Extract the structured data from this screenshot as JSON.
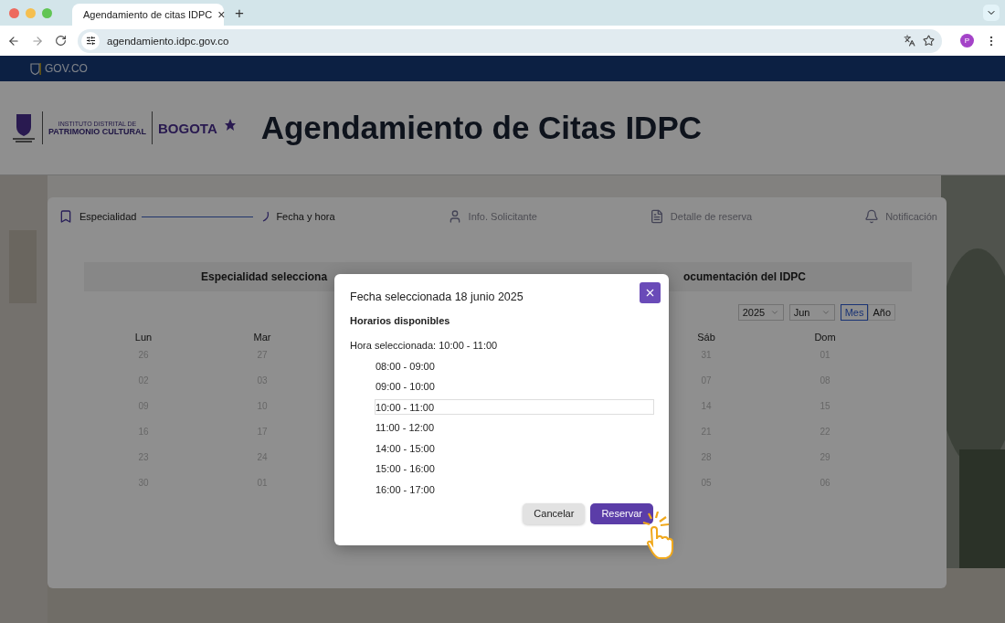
{
  "browser": {
    "tab": {
      "title": "Agendamiento de citas IDPC",
      "close": "×"
    },
    "new_tab": "+",
    "url": "agendamiento.idpc.gov.co",
    "profile": "P"
  },
  "gov_bar": {
    "label": "GOV.CO"
  },
  "header": {
    "logo_line1": "INSTITUTO DISTRITAL DE",
    "logo_line2": "PATRIMONIO CULTURAL",
    "brand": "BOGOTA",
    "title": "Agendamiento de Citas IDPC"
  },
  "steps": [
    {
      "label": "Especialidad",
      "active": true
    },
    {
      "label": "Fecha y hora",
      "active": true
    },
    {
      "label": "Info. Solicitante",
      "active": false
    },
    {
      "label": "Detalle de reserva",
      "active": false
    },
    {
      "label": "Notificación",
      "active": false
    }
  ],
  "specialty": {
    "left": "Especialidad selecciona",
    "right": "ocumentación del IDPC"
  },
  "filters": {
    "year": "2025",
    "month": "Jun",
    "views": [
      {
        "label": "Mes",
        "selected": true
      },
      {
        "label": "Año",
        "selected": false
      }
    ]
  },
  "calendar": {
    "left_columns": [
      {
        "day": "Lun",
        "dates": [
          "26",
          "02",
          "09",
          "16",
          "23",
          "30"
        ]
      },
      {
        "day": "Mar",
        "dates": [
          "27",
          "03",
          "10",
          "17",
          "24",
          "01"
        ]
      }
    ],
    "right_columns": [
      {
        "day": "Sáb",
        "dates": [
          "31",
          "07",
          "14",
          "21",
          "28",
          "05"
        ]
      },
      {
        "day": "Dom",
        "dates": [
          "01",
          "08",
          "15",
          "22",
          "29",
          "06"
        ]
      }
    ]
  },
  "modal": {
    "title": "Fecha seleccionada 18 junio 2025",
    "subtitle": "Horarios disponibles",
    "selected_label": "Hora seleccionada: 10:00 - 11:00",
    "slots": [
      {
        "label": "08:00 - 09:00",
        "selected": false
      },
      {
        "label": "09:00 - 10:00",
        "selected": false
      },
      {
        "label": "10:00 - 11:00",
        "selected": true
      },
      {
        "label": "11:00 - 12:00",
        "selected": false
      },
      {
        "label": "14:00 - 15:00",
        "selected": false
      },
      {
        "label": "15:00 - 16:00",
        "selected": false
      },
      {
        "label": "16:00 - 17:00",
        "selected": false
      }
    ],
    "cancel": "Cancelar",
    "confirm": "Reservar"
  }
}
